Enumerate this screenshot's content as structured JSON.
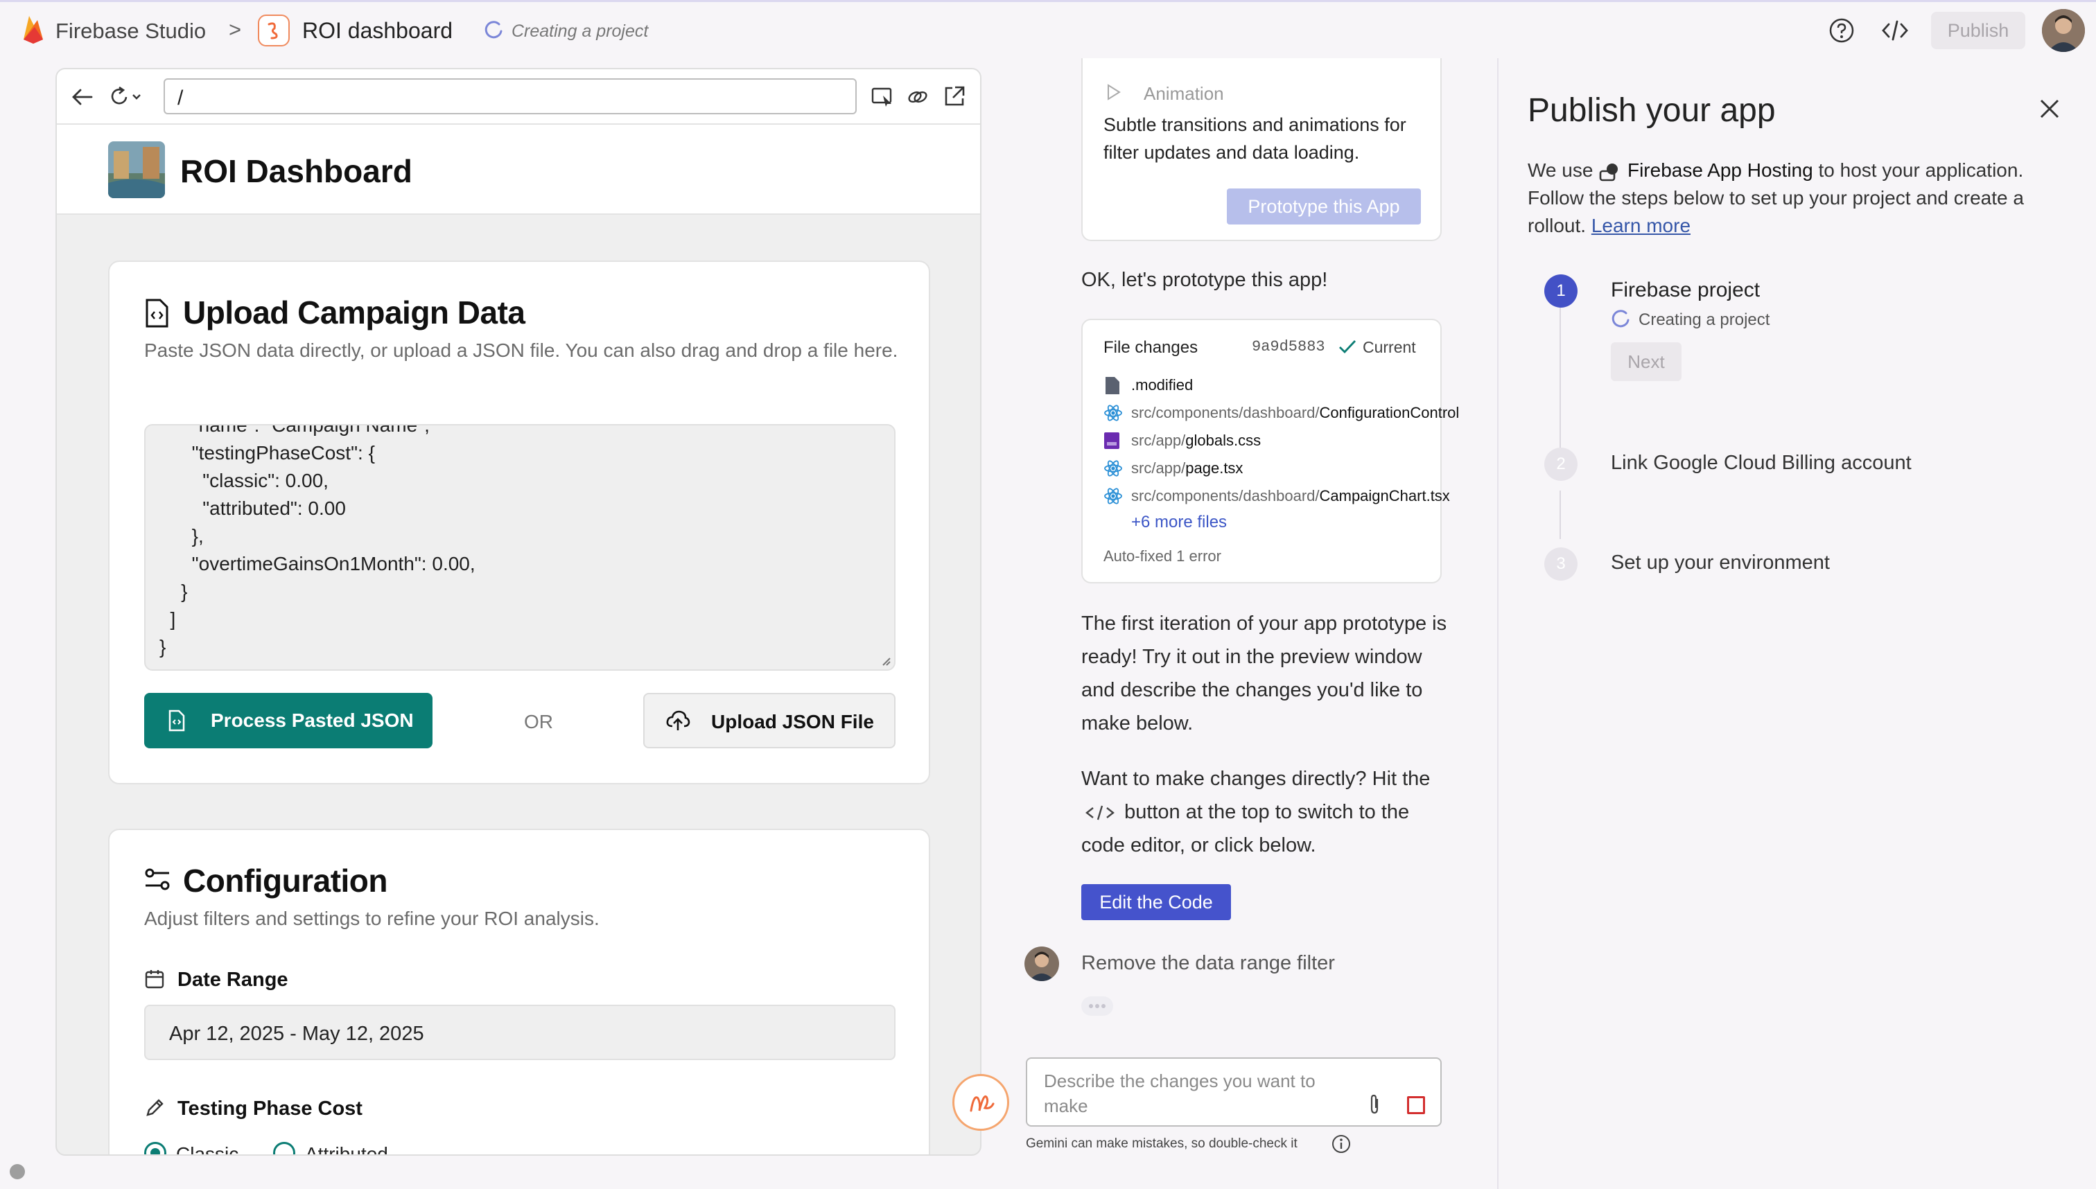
{
  "topbar": {
    "brand": "Firebase Studio",
    "separator": ">",
    "project": "ROI dashboard",
    "status": "Creating a project",
    "publish": "Publish"
  },
  "preview": {
    "url": "/",
    "app_title": "ROI Dashboard",
    "upload": {
      "title": "Upload Campaign Data",
      "desc": "Paste JSON data directly, or upload a JSON file. You can also drag and drop a file here.",
      "code_lines": [
        "      \"name\": \"Campaign Name\",",
        "      \"testingPhaseCost\": {",
        "        \"classic\": 0.00,",
        "        \"attributed\": 0.00",
        "      },",
        "      \"overtimeGainsOn1Month\": 0.00,",
        "    }",
        "  ]",
        "}"
      ],
      "process_btn": "Process Pasted JSON",
      "or": "OR",
      "upload_btn": "Upload JSON File"
    },
    "config": {
      "title": "Configuration",
      "desc": "Adjust filters and settings to refine your ROI analysis.",
      "date_label": "Date Range",
      "date_value": "Apr 12, 2025 - May 12, 2025",
      "tpc_label": "Testing Phase Cost",
      "radio_classic": "Classic",
      "radio_attributed": "Attributed"
    }
  },
  "chat": {
    "animation_label": "Animation",
    "animation_desc": "Subtle transitions and animations for filter updates and data loading.",
    "prototype_btn": "Prototype this App",
    "ok_msg": "OK, let's prototype this app!",
    "file_changes": {
      "title": "File changes",
      "hash": "9a9d5883",
      "current": "Current",
      "files": [
        {
          "dir": "",
          "name": ".modified",
          "icon": "file-icon"
        },
        {
          "dir": "src/components/dashboard/",
          "name": "ConfigurationControl",
          "icon": "react-icon"
        },
        {
          "dir": "src/app/",
          "name": "globals.css",
          "icon": "css-icon"
        },
        {
          "dir": "src/app/",
          "name": "page.tsx",
          "icon": "react-icon"
        },
        {
          "dir": "src/components/dashboard/",
          "name": "CampaignChart.tsx",
          "icon": "react-icon"
        }
      ],
      "more": "+6 more files",
      "autofixed": "Auto-fixed 1 error"
    },
    "ready_msg": "The first iteration of your app prototype is ready! Try it out in the preview window and describe the changes you'd like to make below.",
    "direct_msg_1": "Want to make changes directly? Hit the",
    "direct_msg_2": "button at the top to switch to the code editor, or click below.",
    "edit_btn": "Edit the Code",
    "user_msg": "Remove the data range filter",
    "input_placeholder": "Describe the changes you want to make",
    "disclaimer": "Gemini can make mistakes, so double-check it"
  },
  "publish": {
    "title": "Publish your app",
    "intro_1": "We use",
    "intro_product": "Firebase App Hosting",
    "intro_2": "to host your application. Follow the steps below to set up your project and create a rollout.",
    "learn_more": "Learn more",
    "steps": [
      {
        "num": "1",
        "label": "Firebase project",
        "status": "Creating a project",
        "next": "Next"
      },
      {
        "num": "2",
        "label": "Link Google Cloud Billing account"
      },
      {
        "num": "3",
        "label": "Set up your environment"
      }
    ]
  },
  "colors": {
    "teal": "#0b7d74",
    "indigo": "#4551c9",
    "step_active": "#4351c6",
    "link": "#3556a8"
  }
}
